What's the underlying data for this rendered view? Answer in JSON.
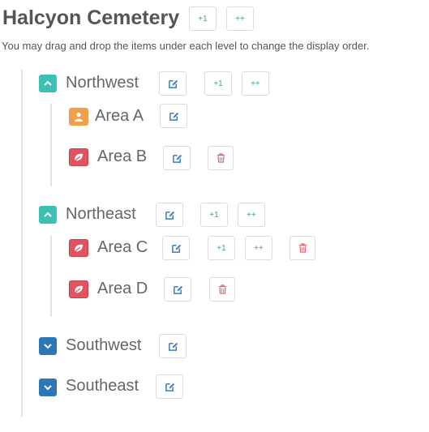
{
  "page": {
    "title": "Halcyon Cemetery",
    "hint": "You may drag and drop the items under each level to change the display order.",
    "add_one_label": "+1",
    "add_many_label": "++"
  },
  "sections": [
    {
      "name": "Northwest",
      "state": "expanded",
      "areas": [
        {
          "name": "Area A",
          "icon": "person-icon",
          "color": "#f0a04a"
        },
        {
          "name": "Area B",
          "icon": "leaf-icon",
          "color": "#e0535f"
        }
      ]
    },
    {
      "name": "Northeast",
      "state": "expanded",
      "areas": [
        {
          "name": "Area C",
          "icon": "leaf-icon",
          "color": "#e0535f"
        },
        {
          "name": "Area D",
          "icon": "leaf-icon",
          "color": "#e0535f"
        }
      ]
    },
    {
      "name": "Southwest",
      "state": "collapsed",
      "areas": []
    },
    {
      "name": "Southeast",
      "state": "collapsed",
      "areas": []
    }
  ],
  "colors": {
    "toggle_open": "#3cbfb4",
    "toggle_closed": "#2e77b5",
    "edit_icon": "#3b7bbf",
    "increment_text": "#3aa86b",
    "delete_icon": "#e06470"
  }
}
